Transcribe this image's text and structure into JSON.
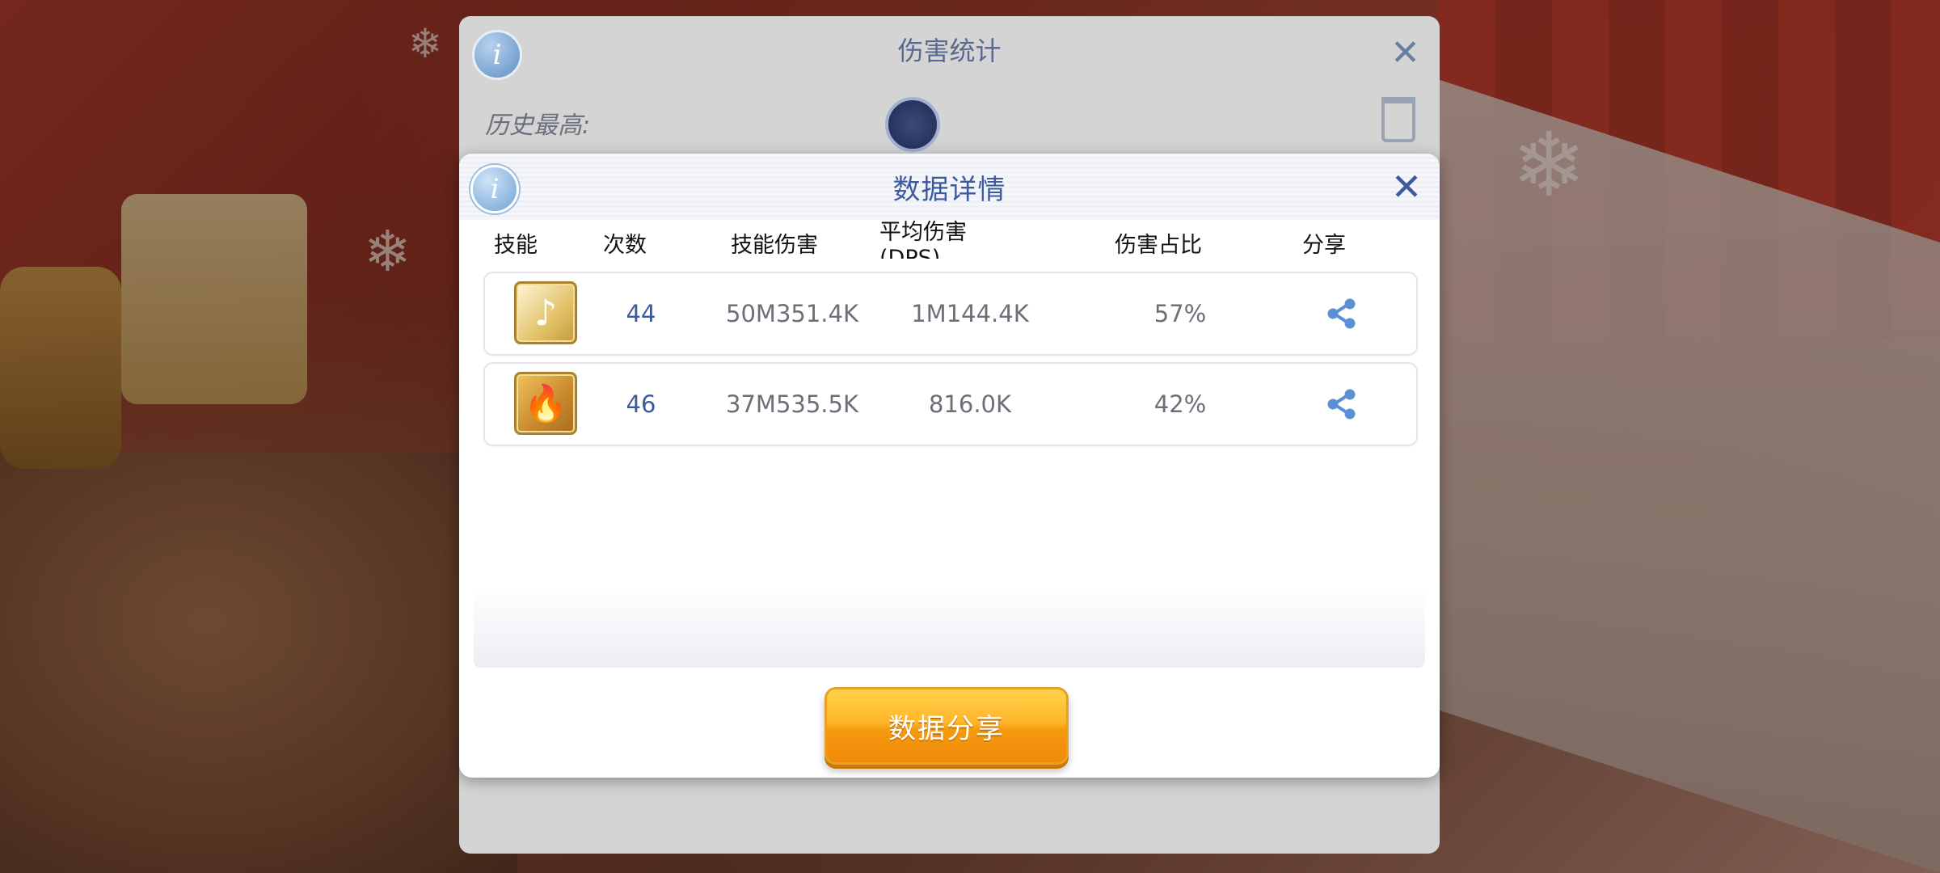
{
  "background_panel": {
    "title": "伤害统计",
    "history_label": "历史最高:"
  },
  "dialog": {
    "title": "数据详情",
    "columns": [
      "技能",
      "次数",
      "技能伤害",
      "平均伤害(DPS)",
      "伤害占比",
      "分享"
    ],
    "rows": [
      {
        "icon": "music-note-skill-icon",
        "count": "44",
        "damage": "50M351.4K",
        "dps": "1M144.4K",
        "ratio": "57%"
      },
      {
        "icon": "flame-skill-icon",
        "count": "46",
        "damage": "37M535.5K",
        "dps": "816.0K",
        "ratio": "42%"
      }
    ],
    "share_button_label": "数据分享"
  },
  "icons": {
    "info": "info-icon",
    "close": "close-icon",
    "share": "share-icon",
    "trash": "trash-icon"
  },
  "colors": {
    "title_blue": "#3c5aa0",
    "share_blue": "#5b8fd6",
    "button_orange": "#f59a0f"
  }
}
